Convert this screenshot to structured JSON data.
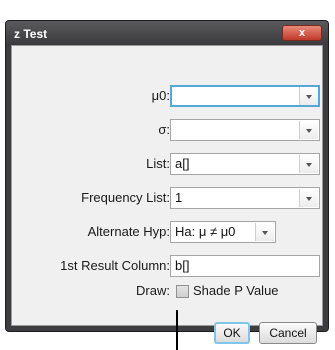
{
  "window": {
    "title": "z Test",
    "close_label": "x"
  },
  "fields": [
    {
      "label": "μ0:",
      "value": ""
    },
    {
      "label": "σ:",
      "value": ""
    },
    {
      "label": "List:",
      "value": "a[]"
    },
    {
      "label": "Frequency List:",
      "value": "1"
    },
    {
      "label": "Alternate Hyp:",
      "value": "Ha: μ ≠ μ0"
    },
    {
      "label": "1st Result Column:",
      "value": "b[]"
    }
  ],
  "draw": {
    "label": "Draw:",
    "checkbox_label": "Shade P Value",
    "checked": false
  },
  "buttons": {
    "ok": "OK",
    "cancel": "Cancel"
  }
}
